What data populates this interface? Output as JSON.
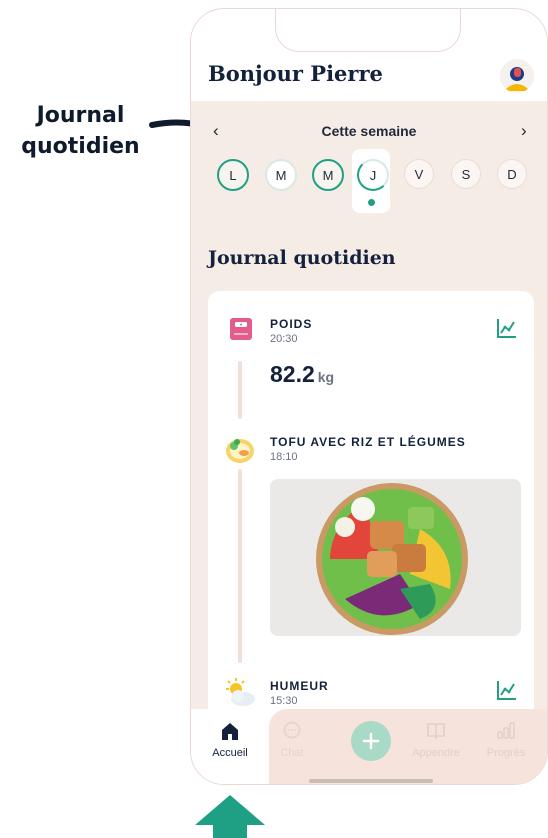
{
  "callout": {
    "line1": "Journal",
    "line2": "quotidien"
  },
  "header": {
    "greeting": "Bonjour Pierre"
  },
  "week": {
    "label": "Cette semaine",
    "prev_icon": "chevron-left-icon",
    "next_icon": "chevron-right-icon",
    "days": [
      "L",
      "M",
      "M",
      "J",
      "V",
      "S",
      "D"
    ],
    "selected_index": 3
  },
  "section": {
    "title": "Journal quotidien"
  },
  "entries": {
    "weight": {
      "title": "POIDS",
      "time": "20:30",
      "value": "82.2",
      "unit": "kg",
      "icon": "scale-icon"
    },
    "meal": {
      "title": "TOFU AVEC RIZ ET LÉGUMES",
      "time": "18:10",
      "icon": "food-plate-icon"
    },
    "mood": {
      "title": "HUMEUR",
      "time": "15:30",
      "icon": "sun-cloud-icon"
    }
  },
  "tabbar": {
    "home": "Accueil",
    "chat": "Chat",
    "learn": "Appendre",
    "progress": "Progrès"
  },
  "colors": {
    "accent": "#1fa085",
    "background": "#f6ece6",
    "title": "#14213d"
  }
}
